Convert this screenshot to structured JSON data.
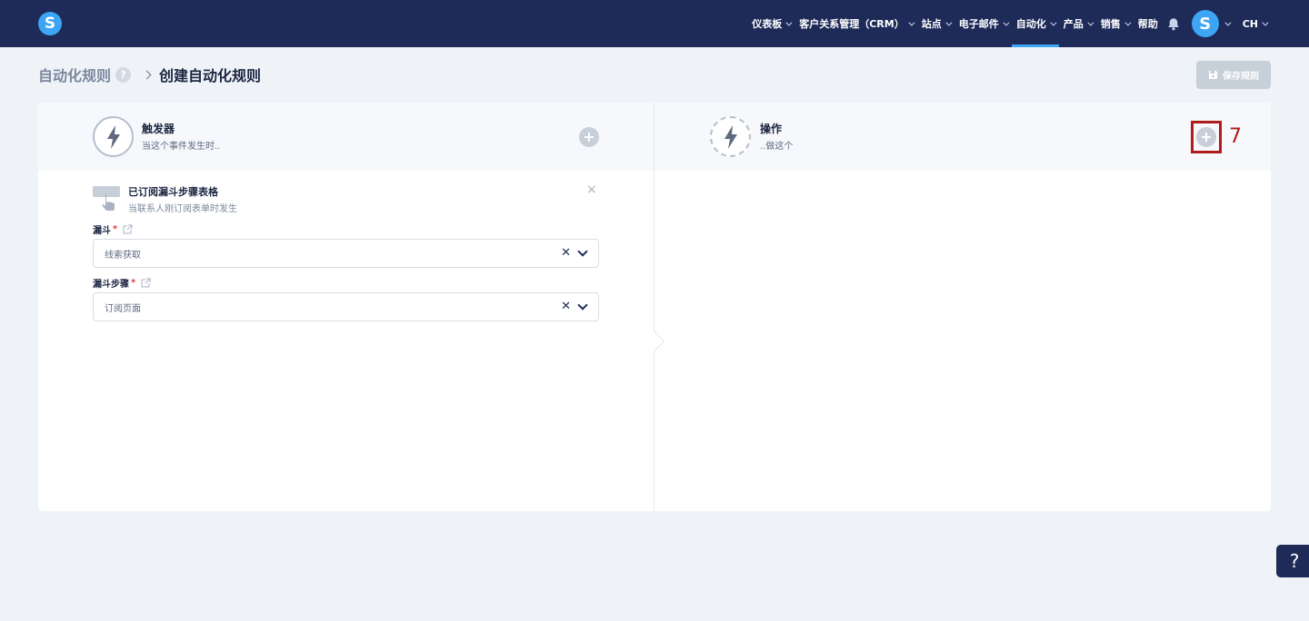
{
  "app": {
    "logo_letter": "S",
    "brand_color": "#3da5f4",
    "nav_bg": "#1e2b58"
  },
  "nav": {
    "items": [
      {
        "label": "仪表板",
        "has_dropdown": true,
        "active": false
      },
      {
        "label": "客户关系管理（CRM）",
        "has_dropdown": true,
        "active": false
      },
      {
        "label": "站点",
        "has_dropdown": true,
        "active": false
      },
      {
        "label": "电子邮件",
        "has_dropdown": true,
        "active": false
      },
      {
        "label": "自动化",
        "has_dropdown": true,
        "active": true
      },
      {
        "label": "产品",
        "has_dropdown": true,
        "active": false
      },
      {
        "label": "销售",
        "has_dropdown": true,
        "active": false
      },
      {
        "label": "帮助",
        "has_dropdown": false,
        "active": false
      }
    ],
    "bell_icon": "bell-icon",
    "avatar_letter": "S",
    "language": "CH"
  },
  "breadcrumb": {
    "parent": "自动化规则",
    "help_symbol": "?",
    "current": "创建自动化规则"
  },
  "toolbar": {
    "save_label": "保存规则",
    "save_icon": "floppy-disk-icon"
  },
  "trigger_panel": {
    "title": "触发器",
    "subtitle": "当这个事件发生时..",
    "icon": "lightning-bolt-icon",
    "add_icon": "plus-circle-icon"
  },
  "action_panel": {
    "title": "操作",
    "subtitle": "..做这个",
    "icon": "lightning-bolt-icon",
    "add_icon": "plus-circle-icon"
  },
  "annotation": {
    "label": "7",
    "color": "#b11b1b"
  },
  "trigger_detail": {
    "icon": "hand-pointer-form-icon",
    "title": "已订阅漏斗步骤表格",
    "subtitle": "当联系人刚订阅表单时发生",
    "close_symbol": "×",
    "fields": [
      {
        "label": "漏斗",
        "required_mark": "*",
        "value": "线索获取",
        "clear_symbol": "✕"
      },
      {
        "label": "漏斗步骤",
        "required_mark": "*",
        "value": "订阅页面",
        "clear_symbol": "✕"
      }
    ]
  },
  "float_help": {
    "symbol": "?"
  }
}
